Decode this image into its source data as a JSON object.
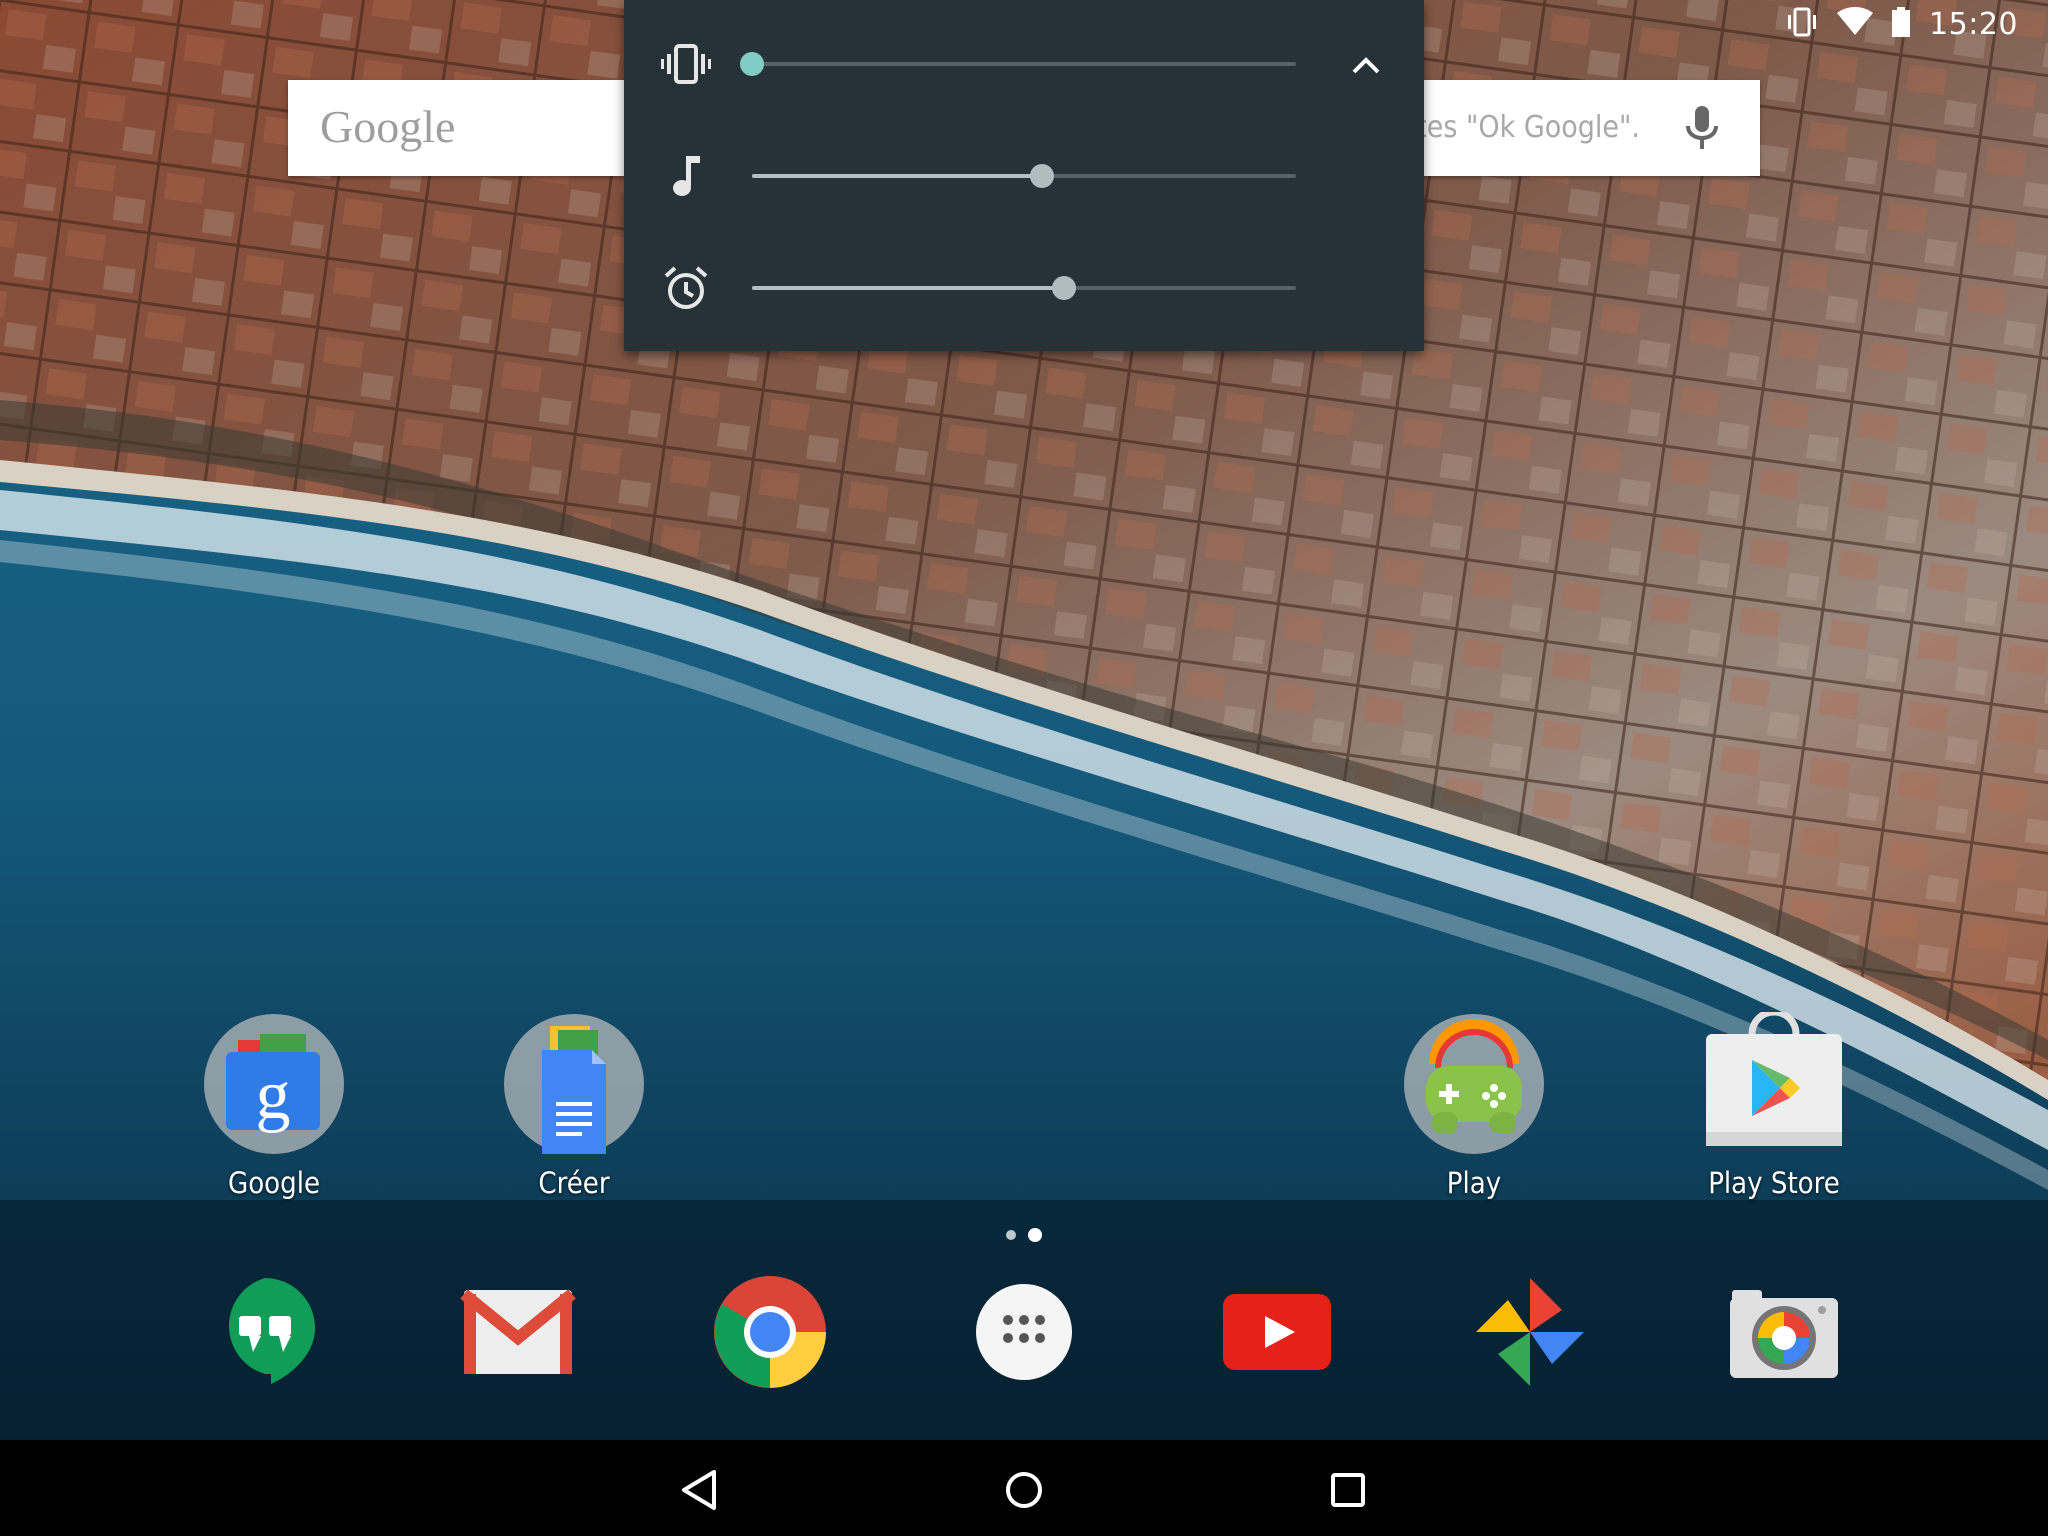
{
  "status_bar": {
    "time": "15:20",
    "icons": [
      "vibrate-icon",
      "wifi-icon",
      "battery-icon"
    ]
  },
  "search_bar": {
    "logo": "Google",
    "hint": "Dites \"Ok Google\".",
    "mic_icon": "mic-icon"
  },
  "volume_panel": {
    "rows": [
      {
        "name": "ringer",
        "icon": "vibrate-icon",
        "level": 0.0
      },
      {
        "name": "media",
        "icon": "music-note-icon",
        "level": 0.534
      },
      {
        "name": "alarm",
        "icon": "alarm-icon",
        "level": 0.574
      }
    ],
    "expand_icon": "chevron-up-icon",
    "accent": "#80cbc4"
  },
  "home_apps": [
    {
      "label": "Google"
    },
    {
      "label": "Créer"
    },
    {
      "label": "Play"
    },
    {
      "label": "Play Store"
    }
  ],
  "page_indicator": {
    "pages": 2,
    "current": 2
  },
  "dock": [
    "hangouts-icon",
    "gmail-icon",
    "chrome-icon",
    "app-drawer-icon",
    "youtube-icon",
    "photos-icon",
    "camera-icon"
  ],
  "nav": [
    "back-icon",
    "home-icon",
    "recents-icon"
  ]
}
